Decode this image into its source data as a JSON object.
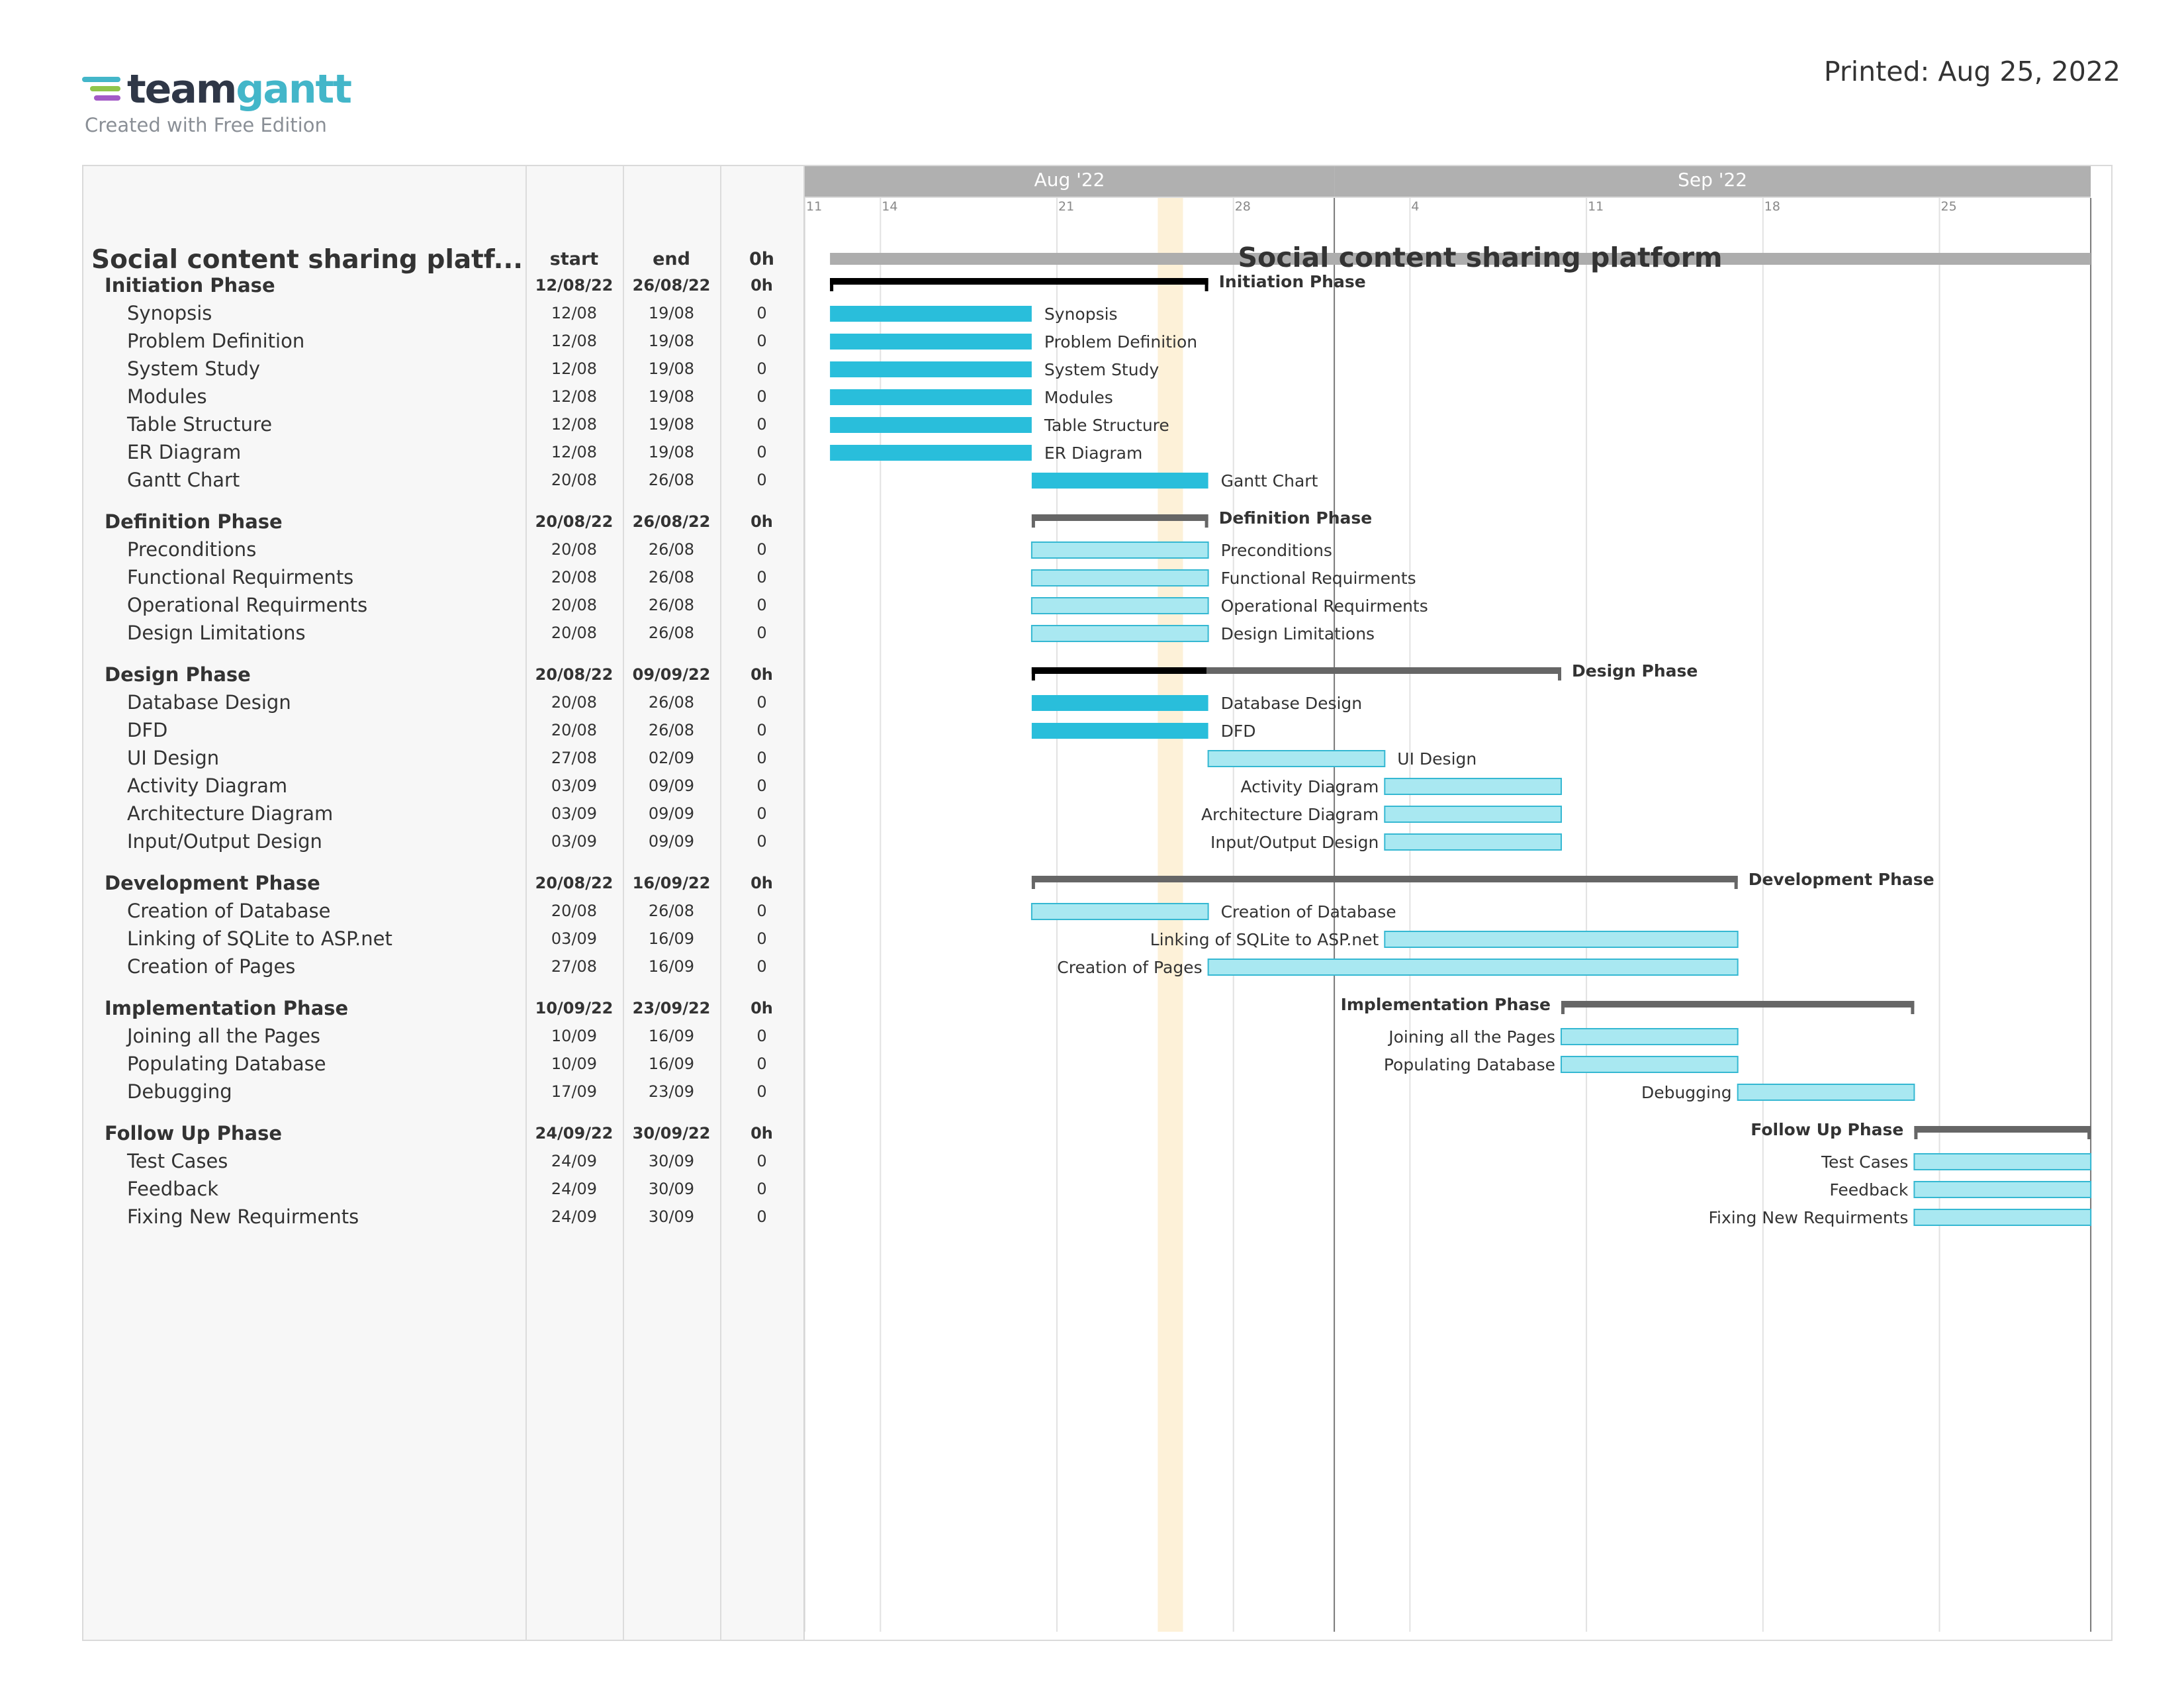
{
  "logo": {
    "word_a": "team",
    "word_b": "gantt",
    "subtitle": "Created with Free Edition"
  },
  "printed": "Printed: Aug 25, 2022",
  "project": {
    "title": "Social content sharing platf...",
    "chart_title": "Social content sharing platform"
  },
  "columns": {
    "start": "start",
    "end": "end",
    "hours": "0h"
  },
  "timeline": {
    "start": "2022-08-11",
    "months": [
      {
        "label": "Aug '22",
        "date": "2022-08-11",
        "end": "2022-09-01"
      },
      {
        "label": "Sep '22",
        "date": "2022-09-01",
        "end": "2022-10-01"
      }
    ],
    "weeks": [
      {
        "label": "11",
        "date": "2022-08-11"
      },
      {
        "label": "14",
        "date": "2022-08-14"
      },
      {
        "label": "21",
        "date": "2022-08-21"
      },
      {
        "label": "28",
        "date": "2022-08-28"
      },
      {
        "label": "4",
        "date": "2022-09-04"
      },
      {
        "label": "11",
        "date": "2022-09-11"
      },
      {
        "label": "18",
        "date": "2022-09-18"
      },
      {
        "label": "25",
        "date": "2022-09-25"
      }
    ],
    "today": "2022-08-25",
    "month_divider": "2022-09-01",
    "end": "2022-10-01"
  },
  "rows": [
    {
      "kind": "phase",
      "name": "Initiation Phase",
      "start": "12/08/22",
      "end": "26/08/22",
      "hours": "0h",
      "s": "2022-08-12",
      "e": "2022-08-26",
      "progress": 1.0
    },
    {
      "kind": "task",
      "name": "Synopsis",
      "start": "12/08",
      "end": "19/08",
      "hours": "0",
      "s": "2022-08-12",
      "e": "2022-08-19",
      "done": true
    },
    {
      "kind": "task",
      "name": "Problem Definition",
      "start": "12/08",
      "end": "19/08",
      "hours": "0",
      "s": "2022-08-12",
      "e": "2022-08-19",
      "done": true
    },
    {
      "kind": "task",
      "name": "System Study",
      "start": "12/08",
      "end": "19/08",
      "hours": "0",
      "s": "2022-08-12",
      "e": "2022-08-19",
      "done": true
    },
    {
      "kind": "task",
      "name": "Modules",
      "start": "12/08",
      "end": "19/08",
      "hours": "0",
      "s": "2022-08-12",
      "e": "2022-08-19",
      "done": true
    },
    {
      "kind": "task",
      "name": "Table Structure",
      "start": "12/08",
      "end": "19/08",
      "hours": "0",
      "s": "2022-08-12",
      "e": "2022-08-19",
      "done": true
    },
    {
      "kind": "task",
      "name": "ER Diagram",
      "start": "12/08",
      "end": "19/08",
      "hours": "0",
      "s": "2022-08-12",
      "e": "2022-08-19",
      "done": true
    },
    {
      "kind": "task",
      "name": "Gantt Chart",
      "start": "20/08",
      "end": "26/08",
      "hours": "0",
      "s": "2022-08-20",
      "e": "2022-08-26",
      "done": true
    },
    {
      "kind": "phase",
      "name": "Definition Phase",
      "start": "20/08/22",
      "end": "26/08/22",
      "hours": "0h",
      "s": "2022-08-20",
      "e": "2022-08-26",
      "progress": 0.0
    },
    {
      "kind": "task",
      "name": "Preconditions",
      "start": "20/08",
      "end": "26/08",
      "hours": "0",
      "s": "2022-08-20",
      "e": "2022-08-26",
      "done": false
    },
    {
      "kind": "task",
      "name": "Functional Requirments",
      "start": "20/08",
      "end": "26/08",
      "hours": "0",
      "s": "2022-08-20",
      "e": "2022-08-26",
      "done": false
    },
    {
      "kind": "task",
      "name": "Operational Requirments",
      "start": "20/08",
      "end": "26/08",
      "hours": "0",
      "s": "2022-08-20",
      "e": "2022-08-26",
      "done": false
    },
    {
      "kind": "task",
      "name": "Design Limitations",
      "start": "20/08",
      "end": "26/08",
      "hours": "0",
      "s": "2022-08-20",
      "e": "2022-08-26",
      "done": false
    },
    {
      "kind": "phase",
      "name": "Design Phase",
      "start": "20/08/22",
      "end": "09/09/22",
      "hours": "0h",
      "s": "2022-08-20",
      "e": "2022-09-09",
      "progress": 0.33
    },
    {
      "kind": "task",
      "name": "Database Design",
      "start": "20/08",
      "end": "26/08",
      "hours": "0",
      "s": "2022-08-20",
      "e": "2022-08-26",
      "done": true
    },
    {
      "kind": "task",
      "name": "DFD",
      "start": "20/08",
      "end": "26/08",
      "hours": "0",
      "s": "2022-08-20",
      "e": "2022-08-26",
      "done": true
    },
    {
      "kind": "task",
      "name": "UI Design",
      "start": "27/08",
      "end": "02/09",
      "hours": "0",
      "s": "2022-08-27",
      "e": "2022-09-02",
      "done": false
    },
    {
      "kind": "task",
      "name": "Activity Diagram",
      "start": "03/09",
      "end": "09/09",
      "hours": "0",
      "s": "2022-09-03",
      "e": "2022-09-09",
      "done": false,
      "label_left": true
    },
    {
      "kind": "task",
      "name": "Architecture Diagram",
      "start": "03/09",
      "end": "09/09",
      "hours": "0",
      "s": "2022-09-03",
      "e": "2022-09-09",
      "done": false,
      "label_left": true
    },
    {
      "kind": "task",
      "name": "Input/Output Design",
      "start": "03/09",
      "end": "09/09",
      "hours": "0",
      "s": "2022-09-03",
      "e": "2022-09-09",
      "done": false,
      "label_left": true
    },
    {
      "kind": "phase",
      "name": "Development Phase",
      "start": "20/08/22",
      "end": "16/09/22",
      "hours": "0h",
      "s": "2022-08-20",
      "e": "2022-09-16",
      "progress": 0.0
    },
    {
      "kind": "task",
      "name": "Creation of Database",
      "start": "20/08",
      "end": "26/08",
      "hours": "0",
      "s": "2022-08-20",
      "e": "2022-08-26",
      "done": false
    },
    {
      "kind": "task",
      "name": "Linking of SQLite to ASP.net",
      "start": "03/09",
      "end": "16/09",
      "hours": "0",
      "s": "2022-09-03",
      "e": "2022-09-16",
      "done": false,
      "label_left": true
    },
    {
      "kind": "task",
      "name": "Creation of Pages",
      "start": "27/08",
      "end": "16/09",
      "hours": "0",
      "s": "2022-08-27",
      "e": "2022-09-16",
      "done": false,
      "label_left": true
    },
    {
      "kind": "phase",
      "name": "Implementation Phase",
      "start": "10/09/22",
      "end": "23/09/22",
      "hours": "0h",
      "s": "2022-09-10",
      "e": "2022-09-23",
      "progress": 0.0,
      "label_left": true
    },
    {
      "kind": "task",
      "name": "Joining all the Pages",
      "start": "10/09",
      "end": "16/09",
      "hours": "0",
      "s": "2022-09-10",
      "e": "2022-09-16",
      "done": false,
      "label_left": true
    },
    {
      "kind": "task",
      "name": "Populating Database",
      "start": "10/09",
      "end": "16/09",
      "hours": "0",
      "s": "2022-09-10",
      "e": "2022-09-16",
      "done": false,
      "label_left": true
    },
    {
      "kind": "task",
      "name": "Debugging",
      "start": "17/09",
      "end": "23/09",
      "hours": "0",
      "s": "2022-09-17",
      "e": "2022-09-23",
      "done": false,
      "label_left": true
    },
    {
      "kind": "phase",
      "name": "Follow Up Phase",
      "start": "24/09/22",
      "end": "30/09/22",
      "hours": "0h",
      "s": "2022-09-24",
      "e": "2022-09-30",
      "progress": 0.0,
      "label_left": true
    },
    {
      "kind": "task",
      "name": "Test Cases",
      "start": "24/09",
      "end": "30/09",
      "hours": "0",
      "s": "2022-09-24",
      "e": "2022-09-30",
      "done": false,
      "label_left": true
    },
    {
      "kind": "task",
      "name": "Feedback",
      "start": "24/09",
      "end": "30/09",
      "hours": "0",
      "s": "2022-09-24",
      "e": "2022-09-30",
      "done": false,
      "label_left": true
    },
    {
      "kind": "task",
      "name": "Fixing New Requirments",
      "start": "24/09",
      "end": "30/09",
      "hours": "0",
      "s": "2022-09-24",
      "e": "2022-09-30",
      "done": false,
      "label_left": true
    }
  ],
  "colors": {
    "done": "#29bedb",
    "todo": "#a9e8f1",
    "todo_border": "#35b8d2",
    "phase": "#666666",
    "phase_progress": "#000000",
    "project_bar": "#adadad",
    "month_header": "#b0b0b0",
    "today": "#fdf1d8",
    "logo_bar_1": "#43b6c9",
    "logo_bar_2": "#8fc54b",
    "logo_bar_3": "#a35ac7"
  }
}
